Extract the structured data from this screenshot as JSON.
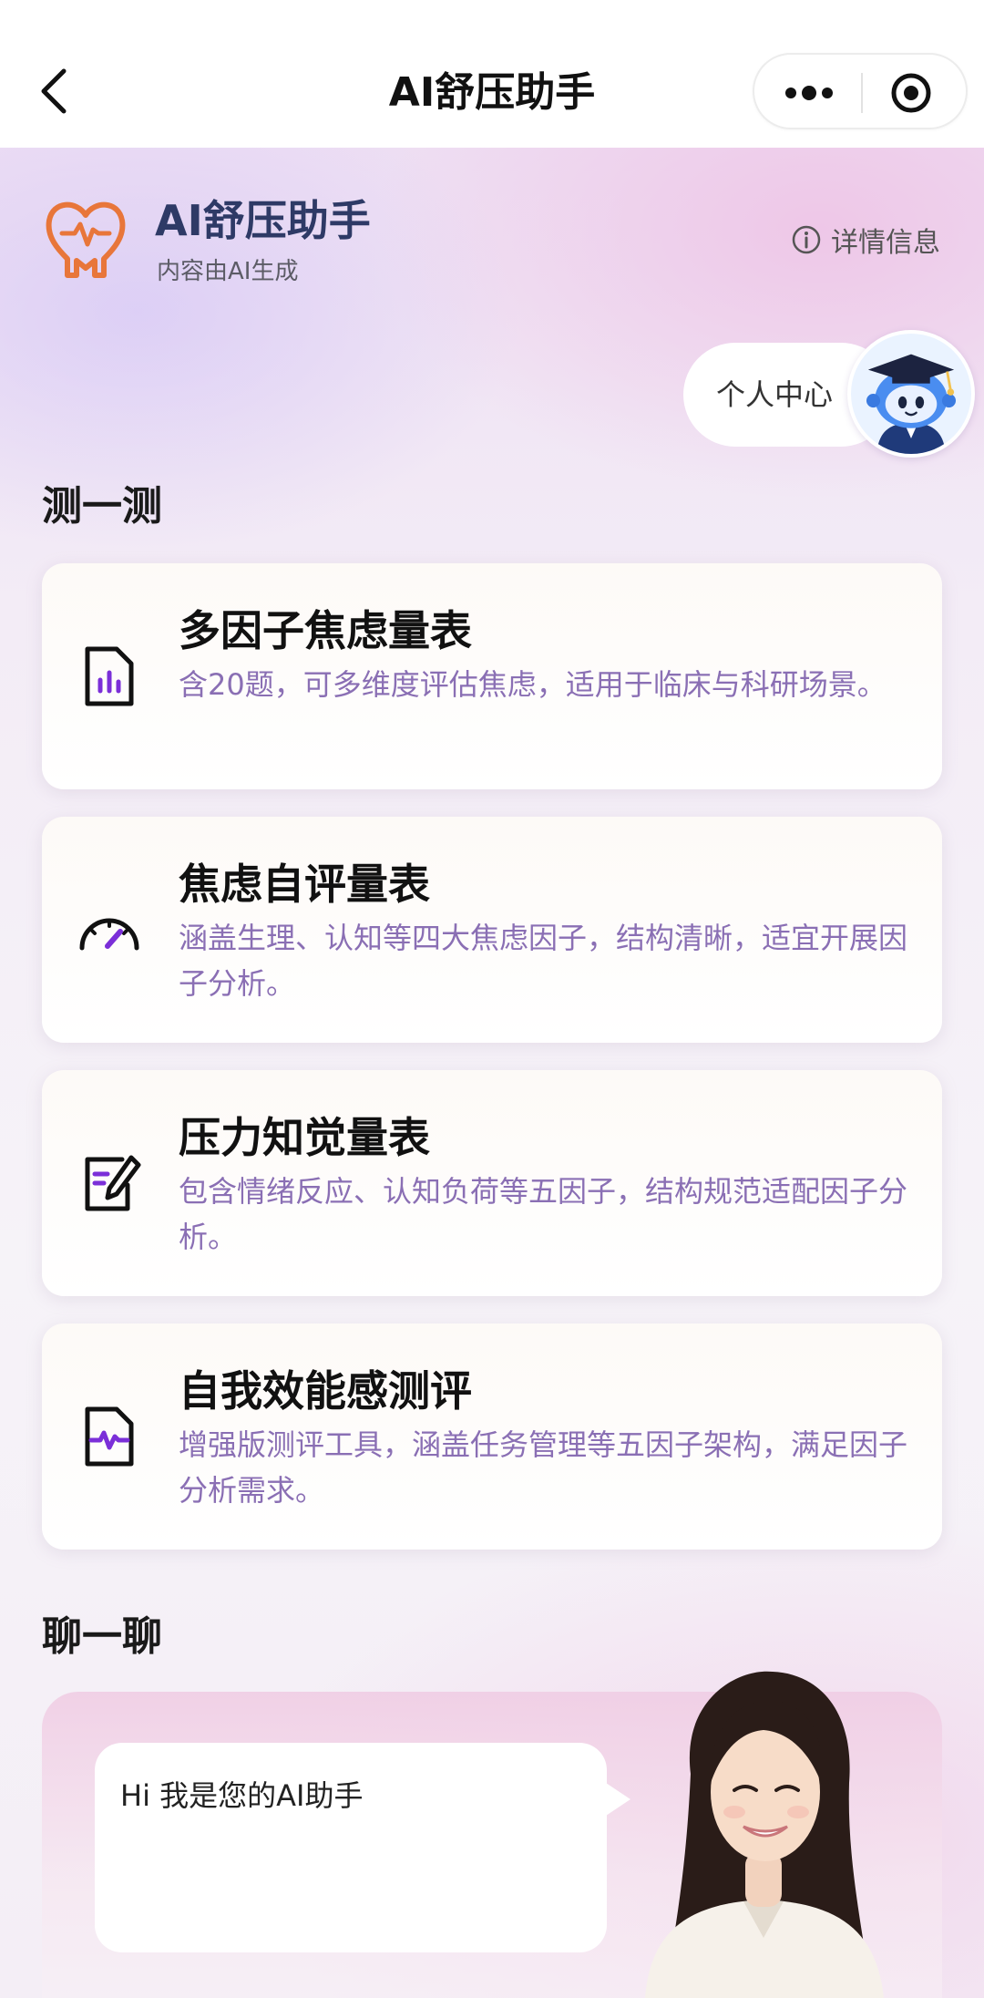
{
  "nav": {
    "title": "AI舒压助手",
    "back_icon": "chevron-left-icon",
    "more_icon": "more-dots-icon",
    "close_icon": "target-circle-icon"
  },
  "brand": {
    "title": "AI舒压助手",
    "subtitle": "内容由AI生成",
    "logo_icon": "heart-pulse-icon",
    "detail_label": "详情信息",
    "accent_color": "#e8763a"
  },
  "personal": {
    "label": "个人中心",
    "avatar_icon": "robot-graduate-avatar"
  },
  "test_section": {
    "title": "测一测",
    "cards": [
      {
        "title": "多因子焦虑量表",
        "desc": "含20题，可多维度评估焦虑，适用于临床与科研场景。",
        "icon": "document-chart-icon"
      },
      {
        "title": "焦虑自评量表",
        "desc": "涵盖生理、认知等四大焦虑因子，结构清晰，适宜开展因子分析。",
        "icon": "gauge-icon"
      },
      {
        "title": "压力知觉量表",
        "desc": "包含情绪反应、认知负荷等五因子，结构规范适配因子分析。",
        "icon": "edit-document-icon"
      },
      {
        "title": "自我效能感测评",
        "desc": "增强版测评工具，涵盖任务管理等五因子架构，满足因子分析需求。",
        "icon": "pulse-document-icon"
      }
    ]
  },
  "chat_section": {
    "title": "聊一聊",
    "greeting": "Hi 我是您的AI助手",
    "assistant_icon": "assistant-portrait"
  },
  "colors": {
    "desc_text": "#8a6fb4",
    "icon_accent": "#7b2fd8",
    "title_text": "#2e3a66"
  }
}
